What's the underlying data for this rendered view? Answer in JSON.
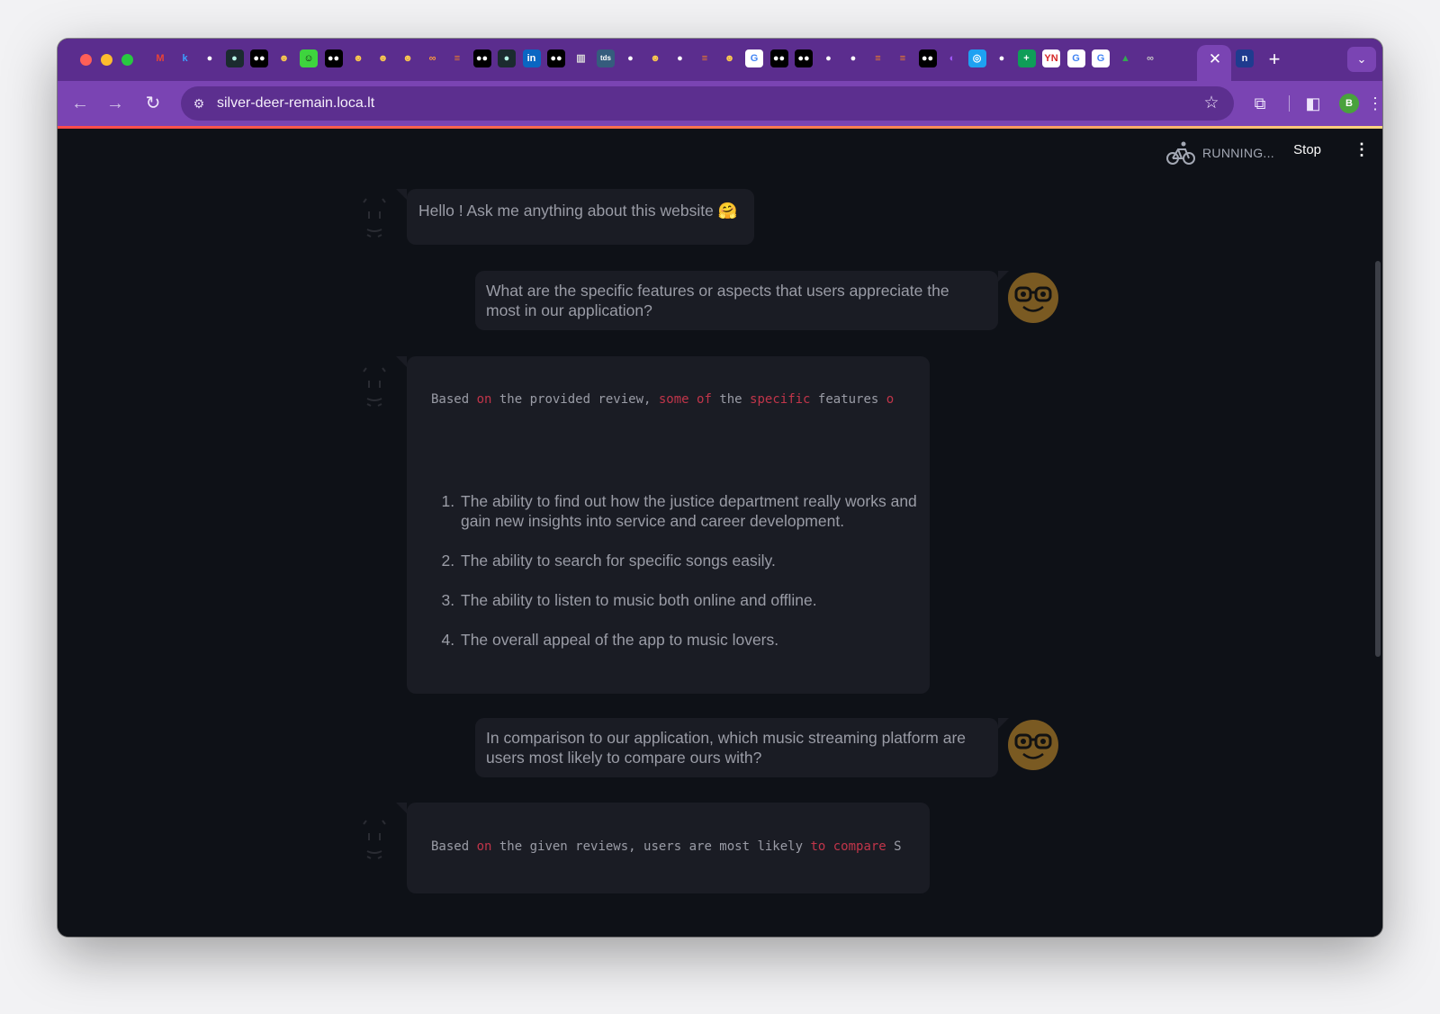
{
  "browser": {
    "url": "silver-deer-remain.loca.lt",
    "profile_initial": "B",
    "tabs": [
      {
        "icon": "gmail-icon",
        "glyph": "M",
        "bg": "transparent",
        "color": "#ea4335"
      },
      {
        "icon": "k-icon",
        "glyph": "k",
        "bg": "transparent",
        "color": "#3ba0ff"
      },
      {
        "icon": "github-icon",
        "glyph": "●",
        "bg": "transparent",
        "color": "#ffffff"
      },
      {
        "icon": "pill-icon",
        "glyph": "●",
        "bg": "#1b2b2f",
        "color": "#b7f3e6"
      },
      {
        "icon": "medium-icon",
        "glyph": "●●",
        "bg": "#000000",
        "color": "#ffffff"
      },
      {
        "icon": "huggingface-icon",
        "glyph": "☻",
        "bg": "transparent",
        "color": "#ffcc4d"
      },
      {
        "icon": "smiley-icon",
        "glyph": "☺",
        "bg": "#3ed43e",
        "color": "#111111"
      },
      {
        "icon": "medium-icon",
        "glyph": "●●",
        "bg": "#000000",
        "color": "#ffffff"
      },
      {
        "icon": "huggingface-icon",
        "glyph": "☻",
        "bg": "transparent",
        "color": "#ffcc4d"
      },
      {
        "icon": "huggingface-icon",
        "glyph": "☻",
        "bg": "transparent",
        "color": "#ffcc4d"
      },
      {
        "icon": "huggingface-icon",
        "glyph": "☻",
        "bg": "transparent",
        "color": "#ffcc4d"
      },
      {
        "icon": "infinity-icon",
        "glyph": "∞",
        "bg": "transparent",
        "color": "#ff9b3d"
      },
      {
        "icon": "stackoverflow-icon",
        "glyph": "≡",
        "bg": "transparent",
        "color": "#f48024"
      },
      {
        "icon": "medium-icon",
        "glyph": "●●",
        "bg": "#000000",
        "color": "#ffffff"
      },
      {
        "icon": "pill-icon",
        "glyph": "●",
        "bg": "#1b2b2f",
        "color": "#b7f3e6"
      },
      {
        "icon": "linkedin-icon",
        "glyph": "in",
        "bg": "#0a66c2",
        "color": "#ffffff"
      },
      {
        "icon": "medium-icon",
        "glyph": "●●",
        "bg": "#000000",
        "color": "#ffffff"
      },
      {
        "icon": "book-icon",
        "glyph": "▥",
        "bg": "transparent",
        "color": "#d9d9d9"
      },
      {
        "icon": "tds-icon",
        "glyph": "tds",
        "bg": "#355c7d",
        "color": "#ffffff"
      },
      {
        "icon": "github-icon",
        "glyph": "●",
        "bg": "transparent",
        "color": "#ffffff"
      },
      {
        "icon": "huggingface-icon",
        "glyph": "☻",
        "bg": "transparent",
        "color": "#ffcc4d"
      },
      {
        "icon": "github-icon",
        "glyph": "●",
        "bg": "transparent",
        "color": "#ffffff"
      },
      {
        "icon": "stackoverflow-icon",
        "glyph": "≡",
        "bg": "transparent",
        "color": "#f48024"
      },
      {
        "icon": "huggingface-icon",
        "glyph": "☻",
        "bg": "transparent",
        "color": "#ffcc4d"
      },
      {
        "icon": "google-icon",
        "glyph": "G",
        "bg": "#ffffff",
        "color": "#4285f4"
      },
      {
        "icon": "medium-icon",
        "glyph": "●●",
        "bg": "#000000",
        "color": "#ffffff"
      },
      {
        "icon": "medium-icon",
        "glyph": "●●",
        "bg": "#000000",
        "color": "#ffffff"
      },
      {
        "icon": "github-icon",
        "glyph": "●",
        "bg": "transparent",
        "color": "#ffffff"
      },
      {
        "icon": "github-icon",
        "glyph": "●",
        "bg": "transparent",
        "color": "#ffffff"
      },
      {
        "icon": "stackoverflow-icon",
        "glyph": "≡",
        "bg": "transparent",
        "color": "#f48024"
      },
      {
        "icon": "stackoverflow-icon",
        "glyph": "≡",
        "bg": "transparent",
        "color": "#f48024"
      },
      {
        "icon": "medium-icon",
        "glyph": "●●",
        "bg": "#000000",
        "color": "#ffffff"
      },
      {
        "icon": "figma-icon",
        "glyph": "◐",
        "bg": "transparent",
        "color": "#a259ff"
      },
      {
        "icon": "safari-icon",
        "glyph": "◎",
        "bg": "#1ea1f2",
        "color": "#ffffff"
      },
      {
        "icon": "github-icon",
        "glyph": "●",
        "bg": "transparent",
        "color": "#ffffff"
      },
      {
        "icon": "sheets-plus-icon",
        "glyph": "+",
        "bg": "#0f9d58",
        "color": "#ffffff"
      },
      {
        "icon": "yn-icon",
        "glyph": "YN",
        "bg": "#ffffff",
        "color": "#d62828"
      },
      {
        "icon": "google-icon",
        "glyph": "G",
        "bg": "#ffffff",
        "color": "#4285f4"
      },
      {
        "icon": "google-icon",
        "glyph": "G",
        "bg": "#ffffff",
        "color": "#4285f4"
      },
      {
        "icon": "google-drive-icon",
        "glyph": "▲",
        "bg": "transparent",
        "color": "#34a853"
      },
      {
        "icon": "infinity-icon",
        "glyph": "∞",
        "bg": "transparent",
        "color": "#c6c6c6"
      }
    ],
    "pinned_after": {
      "icon": "n-icon",
      "glyph": "n",
      "bg": "#1f3b8f",
      "color": "#ffffff"
    }
  },
  "app": {
    "status_text": "RUNNING...",
    "stop_label": "Stop",
    "accent": "#ff4b4b"
  },
  "chat": {
    "greeting": "Hello ! Ask me anything about this website 🤗",
    "q1": "What are the specific features or aspects that users appreciate the most in our application?",
    "a1_code": [
      {
        "t": "Based ",
        "k": false
      },
      {
        "t": "on",
        "k": true
      },
      {
        "t": " the provided review, ",
        "k": false
      },
      {
        "t": "some of",
        "k": true
      },
      {
        "t": " the ",
        "k": false
      },
      {
        "t": "specific",
        "k": true
      },
      {
        "t": " features ",
        "k": false
      },
      {
        "t": "o",
        "k": true
      }
    ],
    "a1_list": [
      "The ability to find out how the justice department really works and gain new insights into service and career development.",
      "The ability to search for specific songs easily.",
      "The ability to listen to music both online and offline.",
      "The overall appeal of the app to music lovers."
    ],
    "q2": "In comparison to our application, which music streaming platform are users most likely to compare ours with?",
    "a2_code": [
      {
        "t": "Based ",
        "k": false
      },
      {
        "t": "on",
        "k": true
      },
      {
        "t": " the given reviews, users are most likely ",
        "k": false
      },
      {
        "t": "to compare",
        "k": true
      },
      {
        "t": " S",
        "k": false
      }
    ]
  }
}
